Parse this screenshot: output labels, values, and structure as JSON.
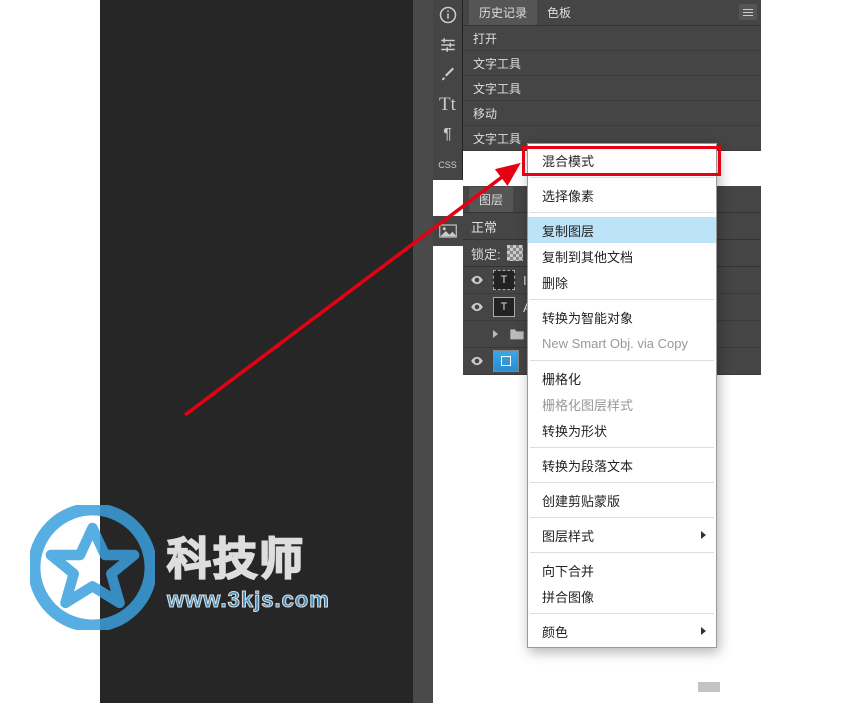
{
  "panels": {
    "history": {
      "tab_history": "历史记录",
      "tab_swatches": "色板",
      "items": [
        "打开",
        "文字工具",
        "文字工具",
        "移动",
        "文字工具"
      ]
    },
    "layers": {
      "tab_layers": "图层",
      "mode_label": "正常",
      "lock_label": "锁定:",
      "rows": [
        {
          "label": "I"
        },
        {
          "label": "A"
        },
        {
          "label": ""
        },
        {
          "label": ""
        }
      ]
    }
  },
  "context_menu": {
    "items": [
      {
        "key": "blend",
        "label": "混合模式"
      },
      {
        "sep": true
      },
      {
        "key": "select-pixels",
        "label": "选择像素"
      },
      {
        "sep": true
      },
      {
        "key": "duplicate-layer",
        "label": "复制图层",
        "highlighted": true
      },
      {
        "key": "copy-to-doc",
        "label": "复制到其他文档"
      },
      {
        "key": "delete",
        "label": "删除"
      },
      {
        "sep": true
      },
      {
        "key": "convert-smart",
        "label": "转换为智能对象"
      },
      {
        "key": "new-smart-copy",
        "label": "New Smart Obj. via Copy",
        "disabled": true
      },
      {
        "sep": true
      },
      {
        "key": "rasterize",
        "label": "栅格化"
      },
      {
        "key": "rasterize-style",
        "label": "栅格化图层样式",
        "disabled": true
      },
      {
        "key": "to-shape",
        "label": "转换为形状"
      },
      {
        "sep": true
      },
      {
        "key": "to-paragraph",
        "label": "转换为段落文本"
      },
      {
        "sep": true
      },
      {
        "key": "clipping-mask",
        "label": "创建剪贴蒙版"
      },
      {
        "sep": true
      },
      {
        "key": "layer-style",
        "label": "图层样式",
        "submenu": true
      },
      {
        "sep": true
      },
      {
        "key": "merge-down",
        "label": "向下合并"
      },
      {
        "key": "flatten",
        "label": "拼合图像"
      },
      {
        "sep": true
      },
      {
        "key": "color",
        "label": "颜色",
        "submenu": true
      }
    ]
  },
  "watermark": {
    "title": "科技师",
    "url": "www.3kjs.com"
  }
}
